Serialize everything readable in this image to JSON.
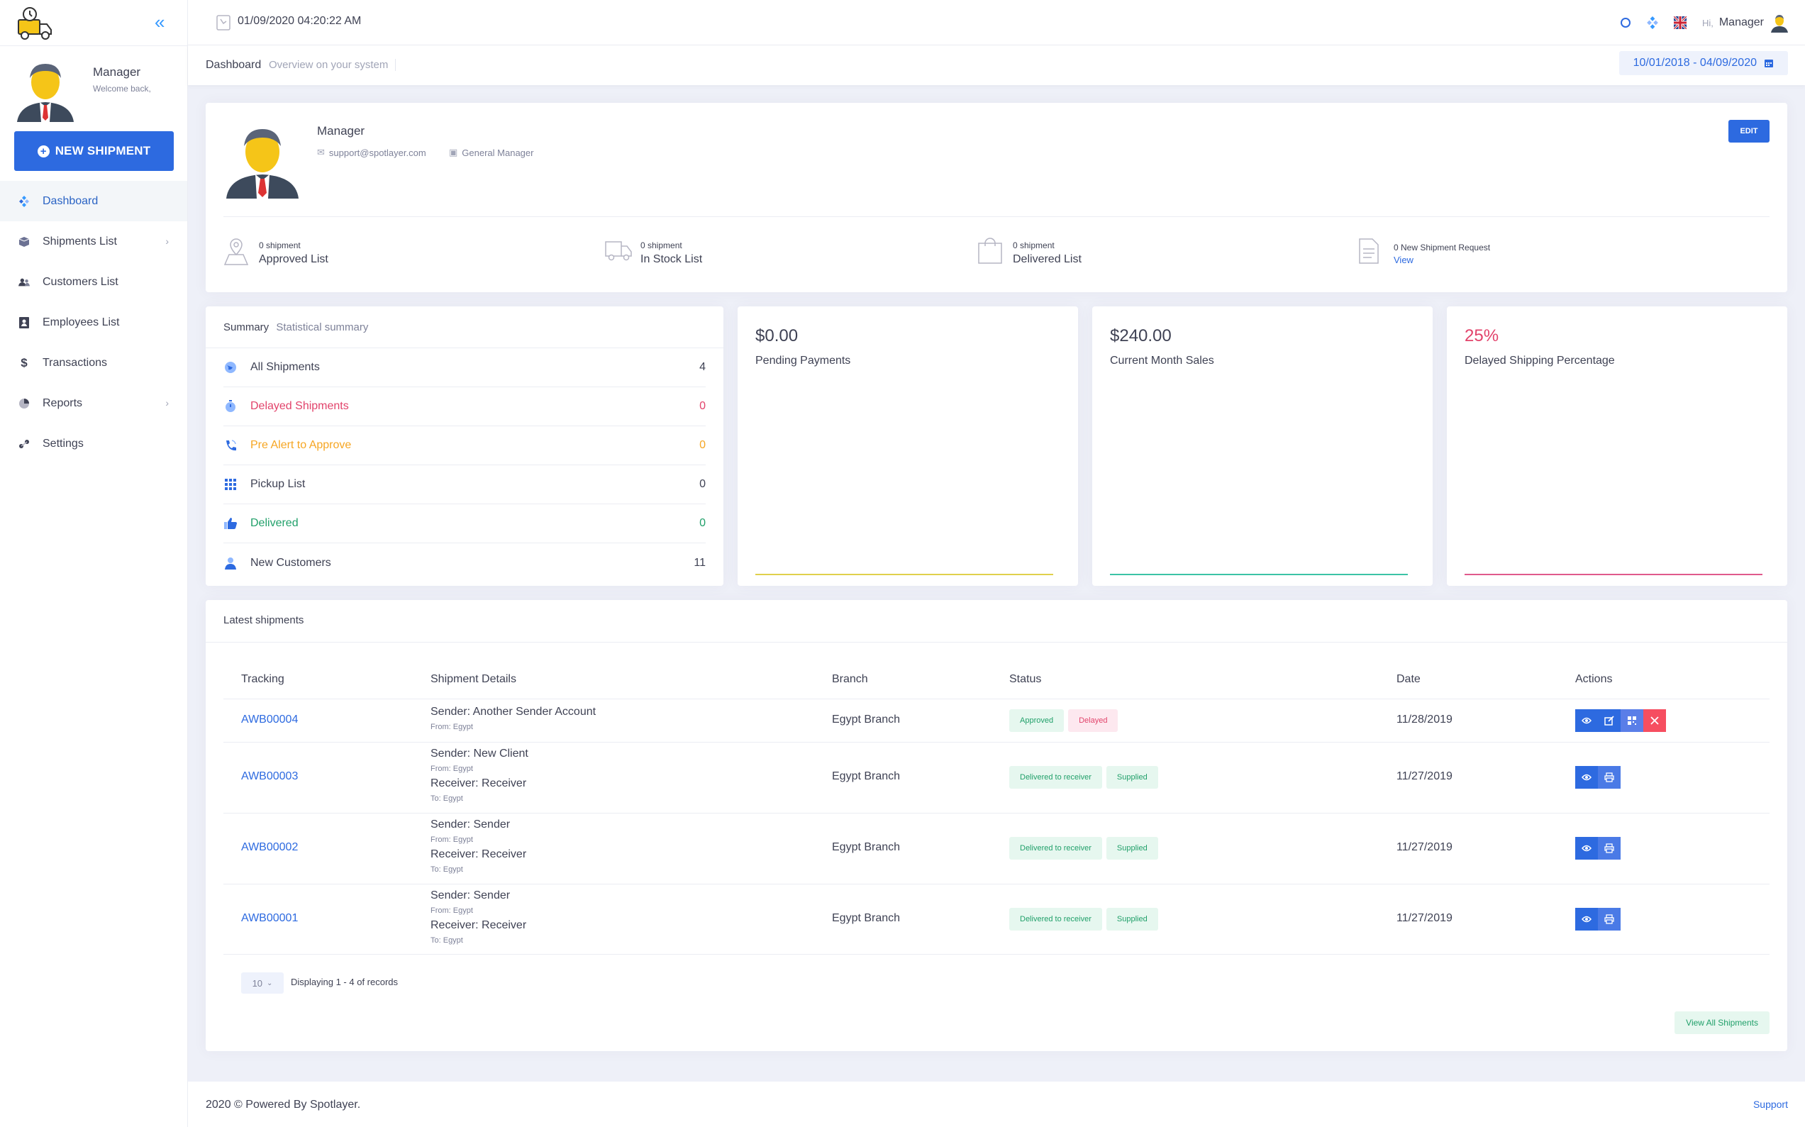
{
  "colors": {
    "primary": "#2d6ae0",
    "danger": "#e2436b",
    "warning": "#f6a623",
    "success": "#21a06a",
    "yellow_line": "#e0d04c",
    "teal_line": "#3cc3a6",
    "pink_line": "#e05a8c"
  },
  "topbar": {
    "datetime": "01/09/2020 04:20:22 AM",
    "greeting": "Hi,",
    "user": "Manager"
  },
  "sidebar": {
    "user_name": "Manager",
    "welcome": "Welcome back,",
    "new_shipment_label": "NEW SHIPMENT",
    "items": [
      {
        "label": "Dashboard",
        "icon": "dashboard-icon"
      },
      {
        "label": "Shipments List",
        "icon": "box-icon"
      },
      {
        "label": "Customers List",
        "icon": "users-icon"
      },
      {
        "label": "Employees List",
        "icon": "id-card-icon"
      },
      {
        "label": "Transactions",
        "icon": "dollar-icon"
      },
      {
        "label": "Reports",
        "icon": "pie-chart-icon"
      },
      {
        "label": "Settings",
        "icon": "settings-icon"
      }
    ]
  },
  "subheader": {
    "title": "Dashboard",
    "subtitle": "Overview on your system",
    "date_range": "10/01/2018 - 04/09/2020"
  },
  "profile": {
    "name": "Manager",
    "email": "support@spotlayer.com",
    "role": "General Manager",
    "edit_label": "EDIT",
    "stats": [
      {
        "count": "0 shipment",
        "label": "Approved List"
      },
      {
        "count": "0 shipment",
        "label": "In Stock List"
      },
      {
        "count": "0 shipment",
        "label": "Delivered List"
      },
      {
        "count": "0 New Shipment Request",
        "link": "View"
      }
    ]
  },
  "summary": {
    "title": "Summary",
    "subtitle": "Statistical summary",
    "rows": [
      {
        "label": "All Shipments",
        "value": "4"
      },
      {
        "label": "Delayed Shipments",
        "value": "0"
      },
      {
        "label": "Pre Alert to Approve",
        "value": "0"
      },
      {
        "label": "Pickup List",
        "value": "0"
      },
      {
        "label": "Delivered",
        "value": "0"
      },
      {
        "label": "New Customers",
        "value": "11"
      }
    ]
  },
  "metrics": [
    {
      "value": "$0.00",
      "label": "Pending Payments"
    },
    {
      "value": "$240.00",
      "label": "Current Month Sales"
    },
    {
      "value": "25%",
      "label": "Delayed Shipping Percentage"
    }
  ],
  "latest": {
    "title": "Latest shipments",
    "headers": [
      "Tracking",
      "Shipment Details",
      "Branch",
      "Status",
      "Date",
      "Actions"
    ],
    "rows": [
      {
        "tracking": "AWB00004",
        "sender": "Sender: Another Sender Account",
        "from": "From: Egypt",
        "branch": "Egypt Branch",
        "status": [
          "Approved",
          "Delayed"
        ],
        "date": "11/28/2019"
      },
      {
        "tracking": "AWB00003",
        "sender": "Sender: New Client",
        "from": "From: Egypt",
        "receiver": "Receiver: Receiver",
        "to": "To: Egypt",
        "branch": "Egypt Branch",
        "status": [
          "Delivered to receiver",
          "Supplied"
        ],
        "date": "11/27/2019"
      },
      {
        "tracking": "AWB00002",
        "sender": "Sender: Sender",
        "from": "From: Egypt",
        "receiver": "Receiver: Receiver",
        "to": "To: Egypt",
        "branch": "Egypt Branch",
        "status": [
          "Delivered to receiver",
          "Supplied"
        ],
        "date": "11/27/2019"
      },
      {
        "tracking": "AWB00001",
        "sender": "Sender: Sender",
        "from": "From: Egypt",
        "receiver": "Receiver: Receiver",
        "to": "To: Egypt",
        "branch": "Egypt Branch",
        "status": [
          "Delivered to receiver",
          "Supplied"
        ],
        "date": "11/27/2019"
      }
    ],
    "page_size": "10",
    "pager_info": "Displaying 1 - 4 of records",
    "view_all": "View All Shipments"
  },
  "footer": {
    "copyright": "2020 © Powered By Spotlayer.",
    "support": "Support"
  }
}
